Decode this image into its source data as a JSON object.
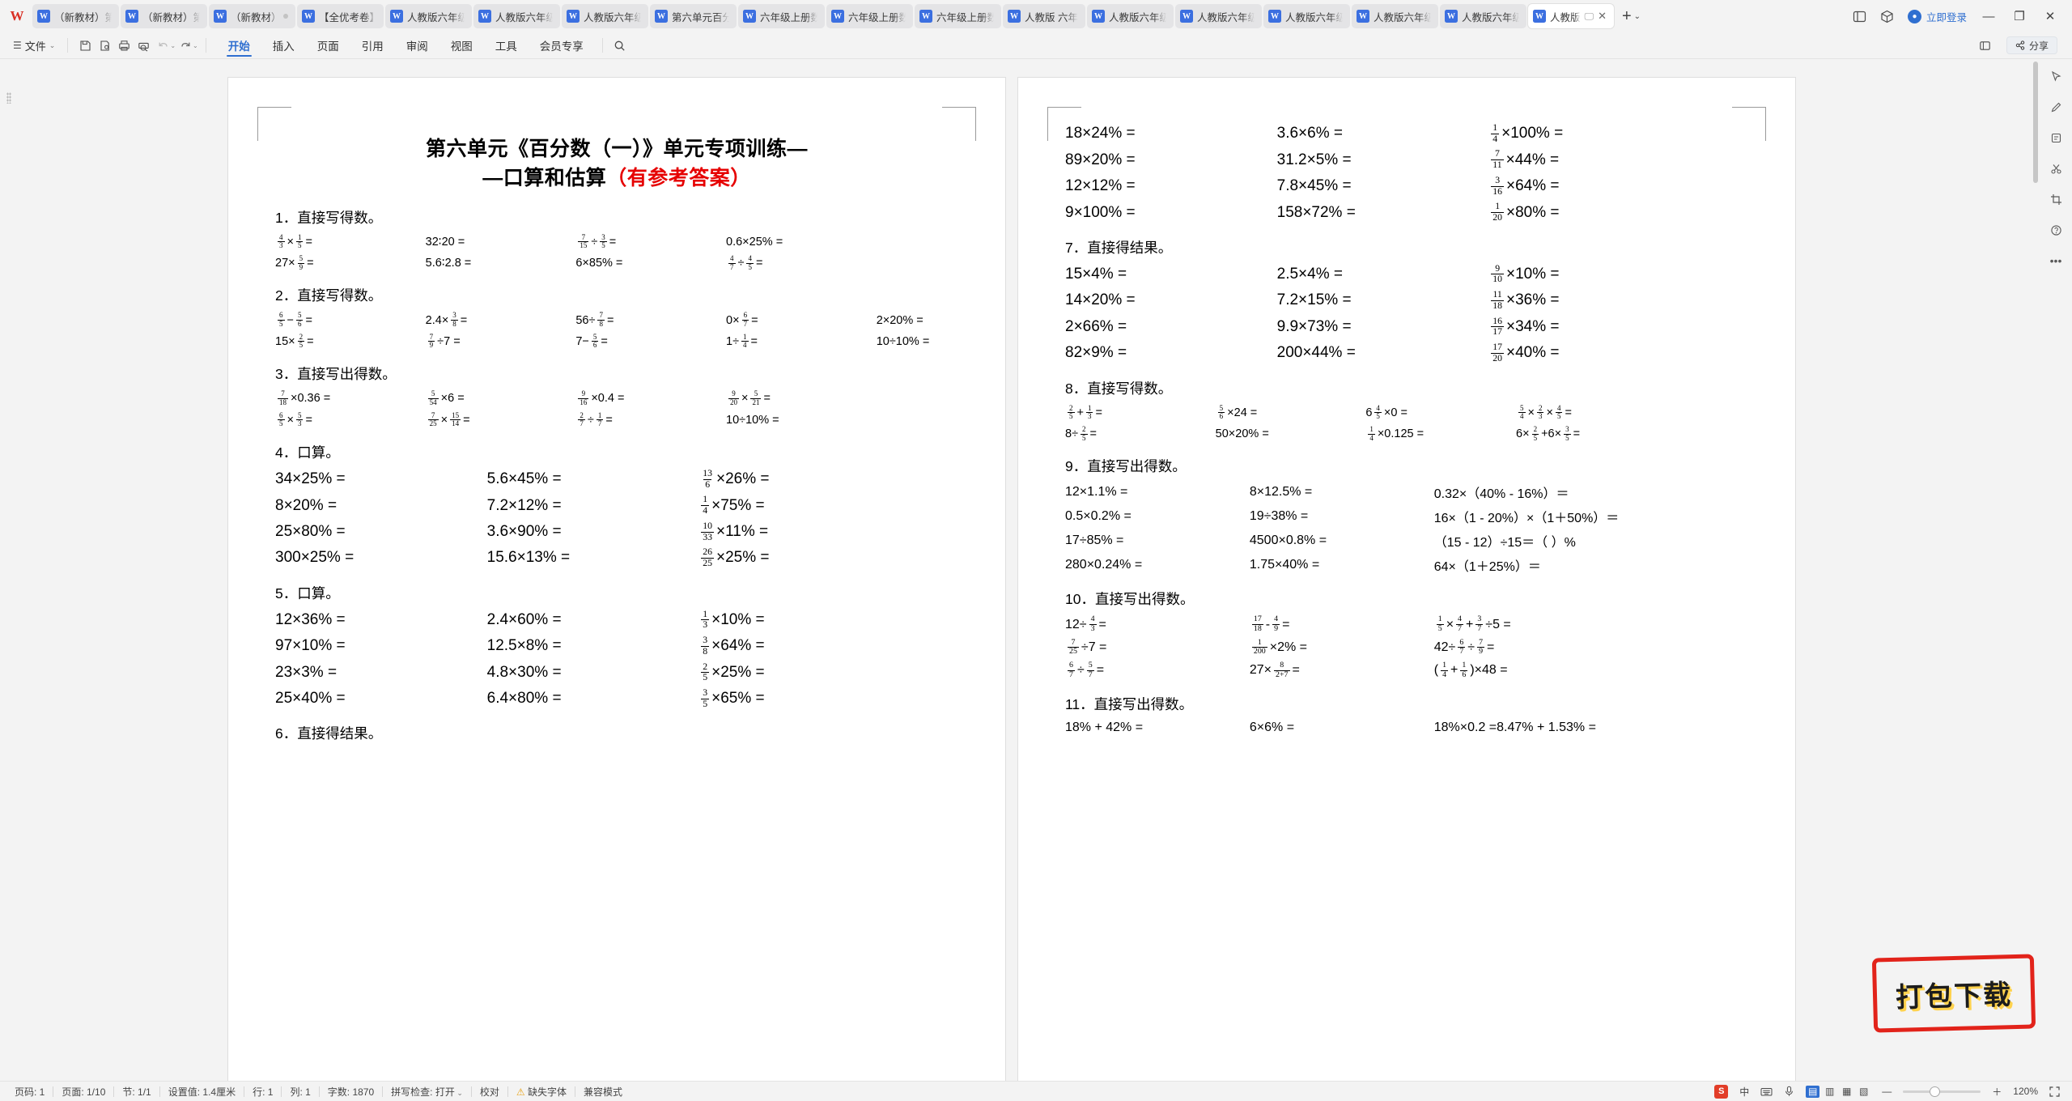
{
  "window": {
    "app_logo": "W",
    "tabs": [
      {
        "label": "（新教材）第",
        "icon": "word-doc-icon"
      },
      {
        "label": "（新教材）第",
        "icon": "word-doc-icon"
      },
      {
        "label": "（新教材）",
        "icon": "word-doc-icon"
      },
      {
        "label": "【全优考卷】",
        "icon": "word-doc-icon"
      },
      {
        "label": "人教版六年级",
        "icon": "word-doc-icon"
      },
      {
        "label": "人教版六年级",
        "icon": "word-doc-icon"
      },
      {
        "label": "人教版六年级",
        "icon": "word-doc-icon"
      },
      {
        "label": "第六单元百分",
        "icon": "word-doc-icon"
      },
      {
        "label": "六年级上册数",
        "icon": "word-doc-icon"
      },
      {
        "label": "六年级上册数",
        "icon": "word-doc-icon"
      },
      {
        "label": "六年级上册数",
        "icon": "word-doc-icon"
      },
      {
        "label": "人教版 六年",
        "icon": "word-doc-icon"
      },
      {
        "label": "人教版六年级",
        "icon": "word-doc-icon"
      },
      {
        "label": "人教版六年级",
        "icon": "word-doc-icon"
      },
      {
        "label": "人教版六年级",
        "icon": "word-doc-icon"
      },
      {
        "label": "人教版六年级",
        "icon": "word-doc-icon"
      },
      {
        "label": "人教版六年级",
        "icon": "word-doc-icon"
      },
      {
        "label": "人教版",
        "icon": "word-doc-icon",
        "active": true
      }
    ],
    "new_tab": "+",
    "new_tab_chevron": "⌄",
    "login_label": "立即登录",
    "minimize": "—",
    "restore": "❐",
    "close": "✕"
  },
  "ribbon": {
    "file_label": "文件",
    "file_chevron": "⌄",
    "quick": [
      "save-icon",
      "save-as-icon",
      "print-icon",
      "print-preview-icon",
      "undo-icon",
      "redo-icon"
    ],
    "menu": [
      {
        "label": "开始",
        "active": true
      },
      {
        "label": "插入",
        "active": false
      },
      {
        "label": "页面",
        "active": false
      },
      {
        "label": "引用",
        "active": false
      },
      {
        "label": "审阅",
        "active": false
      },
      {
        "label": "视图",
        "active": false
      },
      {
        "label": "工具",
        "active": false
      },
      {
        "label": "会员专享",
        "active": false
      }
    ],
    "search_icon": "search-icon",
    "share_label": "分享"
  },
  "document": {
    "title_line1": "第六单元《百分数（一）》单元专项训练—",
    "title_line2_plain": "—口算和估算",
    "title_line2_red": "（有参考答案）",
    "sections": [
      {
        "number": "1．",
        "heading": "直接写得数。",
        "size": "sm",
        "rows": [
          [
            "{4/3}×{1/5}=",
            "32∶20 =",
            "{7/15}÷{3/5}=",
            "0.6×25% ="
          ],
          [
            "27×{5/9}=",
            "5.6∶2.8 =",
            "6×85% =",
            "{4/7}÷{4/5}="
          ]
        ]
      },
      {
        "number": "2．",
        "heading": "直接写得数。",
        "size": "sm",
        "rows": [
          [
            "{6/5}−{5/6}=",
            "2.4×{3/8}=",
            "56÷{7/8}=",
            "0×{6/7}=",
            "2×20% ="
          ],
          [
            "15×{2/5}=",
            "{7/9}÷7 =",
            "7−{5/6}=",
            "1÷{1/4}=",
            "10÷10% ="
          ]
        ]
      },
      {
        "number": "3．",
        "heading": "直接写出得数。",
        "size": "sm",
        "rows": [
          [
            "{7/18}×0.36 =",
            "{5/54}×6 =",
            "{9/16}×0.4 =",
            "{9/20}×{5/21}="
          ],
          [
            "{6/5}×{5/3}=",
            "{7/25}×{15/14}=",
            "{2/7}÷{1/7}=",
            "10÷10% ="
          ]
        ]
      },
      {
        "number": "4．",
        "heading": "口算。",
        "size": "big",
        "rows": [
          [
            "34×25% =",
            "5.6×45% =",
            "{13/6}×26% ="
          ],
          [
            "8×20% =",
            "7.2×12% =",
            "{1/4}×75% ="
          ],
          [
            "25×80% =",
            "3.6×90% =",
            "{10/33}×11% ="
          ],
          [
            "300×25% =",
            "15.6×13% =",
            "{26/25}×25% ="
          ]
        ]
      },
      {
        "number": "5．",
        "heading": "口算。",
        "size": "big",
        "rows": [
          [
            "12×36% =",
            "2.4×60% =",
            "{1/3}×10% ="
          ],
          [
            "97×10% =",
            "12.5×8% =",
            "{3/8}×64% ="
          ],
          [
            "23×3% =",
            "4.8×30% =",
            "{2/5}×25% ="
          ],
          [
            "25×40% =",
            "6.4×80% =",
            "{3/5}×65% ="
          ]
        ]
      },
      {
        "number": "6．",
        "heading": "直接得结果。",
        "size": "big",
        "rows": []
      }
    ],
    "sections_right": [
      {
        "number": "",
        "heading": "",
        "size": "big",
        "rows": [
          [
            "18×24% =",
            "3.6×6% =",
            "{1/4}×100% ="
          ],
          [
            "89×20% =",
            "31.2×5% =",
            "{7/11}×44% ="
          ],
          [
            "12×12% =",
            "7.8×45% =",
            "{3/16}×64% ="
          ],
          [
            "9×100% =",
            "158×72% =",
            "{1/20}×80% ="
          ]
        ]
      },
      {
        "number": "7．",
        "heading": "直接得结果。",
        "size": "big",
        "rows": [
          [
            "15×4% =",
            "2.5×4% =",
            "{9/10}×10% ="
          ],
          [
            "14×20% =",
            "7.2×15% =",
            "{11/18}×36% ="
          ],
          [
            "2×66% =",
            "9.9×73% =",
            "{16/17}×34% ="
          ],
          [
            "82×9% =",
            "200×44% =",
            "{17/20}×40% ="
          ]
        ]
      },
      {
        "number": "8．",
        "heading": "直接写得数。",
        "size": "sm",
        "rows": [
          [
            "{2/5}+{1/3}=",
            "{5/6}×24 =",
            "6{4/5}×0 =",
            "{5/4}×{2/3}×{4/5}="
          ],
          [
            "8÷{2/5}=",
            "50×20% =",
            "{1/4}×0.125 =",
            "6×{2/5}+6×{3/5}="
          ]
        ]
      },
      {
        "number": "9．",
        "heading": "直接写出得数。",
        "size": "md",
        "rows": [
          [
            "12×1.1% =",
            "8×12.5% =",
            "0.32×（40% - 16%）＝"
          ],
          [
            "0.5×0.2% =",
            "19÷38% =",
            "16×（1 - 20%）×（1＋50%）＝"
          ],
          [
            "17÷85% =",
            "4500×0.8% =",
            "（15 - 12）÷15＝（    ）%"
          ],
          [
            "280×0.24% =",
            "1.75×40% =",
            "64×（1＋25%）＝"
          ]
        ]
      },
      {
        "number": "10．",
        "heading": "直接写出得数。",
        "size": "md",
        "rows": [
          [
            "12÷{4/3}=",
            "{17/18}-{4/9}=",
            "{1/5}×{4/7}+{3/7}÷5 ="
          ],
          [
            "{7/25}÷7 =",
            "{1/200}×2% =",
            "42÷{6/7}÷{7/9}="
          ],
          [
            "{6/7}÷{5/7}=",
            "27×{8/2+7}=",
            "({1/4}+{1/6})×48 ="
          ]
        ]
      },
      {
        "number": "11．",
        "heading": "直接写出得数。",
        "size": "md",
        "rows": [
          [
            "18% + 42% =",
            "6×6% =",
            "18%×0.2 =",
            "8.47% + 1.53% ="
          ]
        ]
      }
    ]
  },
  "watermark": {
    "label": "打包下载"
  },
  "status": {
    "left": [
      "页码: 1",
      "页面: 1/10",
      "节: 1/1",
      "设置值: 1.4厘米",
      "行: 1",
      "列: 1",
      "字数: 1870",
      "拼写检查: 打开",
      "校对",
      "缺失字体",
      "兼容模式"
    ],
    "spell_chevron": "⌄",
    "warn_icon": "warning-icon",
    "right": {
      "badge": "S",
      "ime": "中",
      "zoom_level": "120%",
      "zoom_out": "—",
      "zoom_in": "＋"
    }
  },
  "colors": {
    "accent": "#2f6fd0",
    "title_red": "#e60000",
    "stamp_red": "#e2231a",
    "stamp_shadow": "#ffd24d"
  }
}
